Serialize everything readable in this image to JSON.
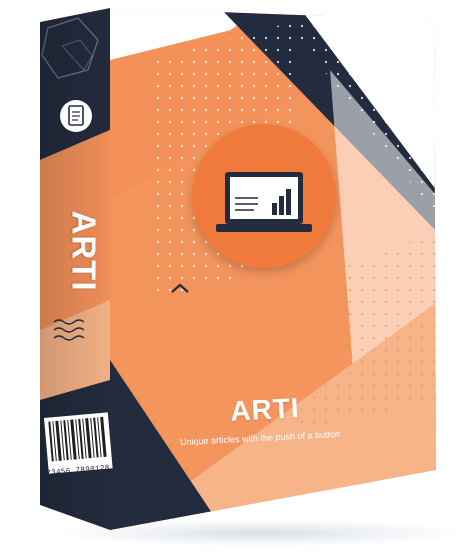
{
  "product": {
    "spine_title": "ARTI",
    "front_title": "ARTI",
    "tagline": "Unique articles with the push of a button",
    "barcode_number": "23456 7890128"
  },
  "colors": {
    "orange": "#F4915A",
    "peach": "#F7B488",
    "navy": "#232B3E",
    "white": "#FFFFFF",
    "circle_orange": "#F07A3A"
  },
  "icons": {
    "front_center": "laptop-chart-icon",
    "spine_top": "document-icon",
    "front_small_chevron": "chevron-up-icon",
    "spine_wave": "wave-lines-icon",
    "top_right_corner": "diamond-icon"
  }
}
